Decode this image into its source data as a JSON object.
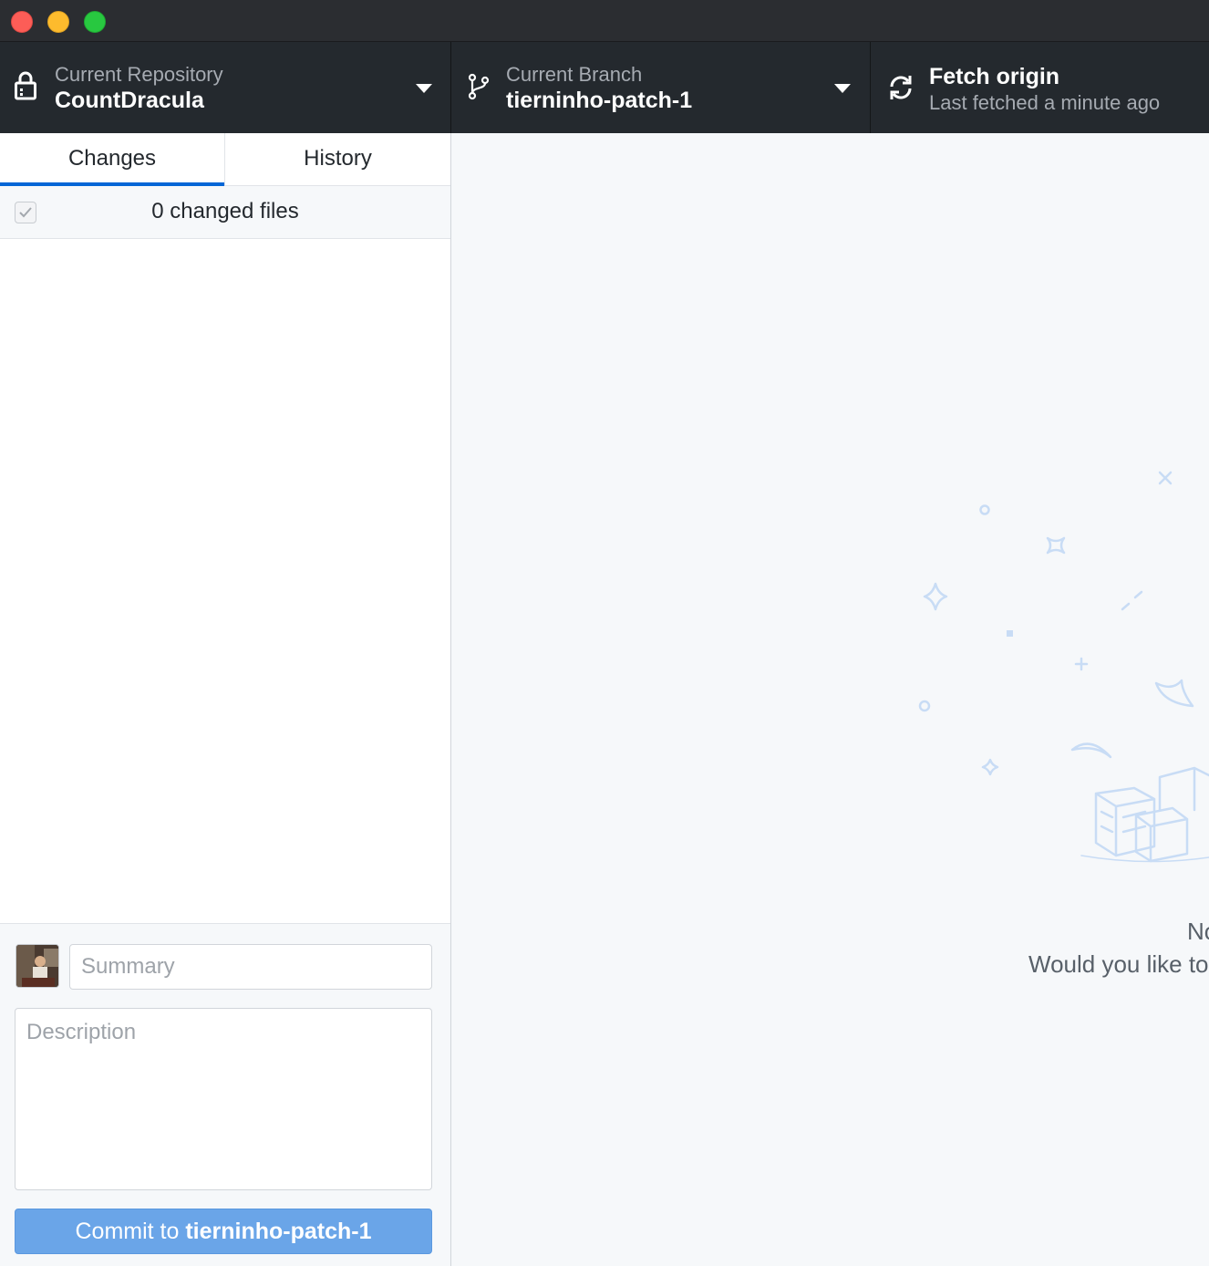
{
  "window": {
    "controls": [
      "close",
      "minimize",
      "maximize"
    ]
  },
  "toolbar": {
    "repository": {
      "label": "Current Repository",
      "value": "CountDracula",
      "icon": "lock-icon"
    },
    "branch": {
      "label": "Current Branch",
      "value": "tierninho-patch-1",
      "icon": "git-branch-icon"
    },
    "fetch": {
      "label": "Fetch origin",
      "status": "Last fetched a minute ago",
      "icon": "sync-icon"
    }
  },
  "sidebar": {
    "tabs": [
      {
        "label": "Changes",
        "selected": true
      },
      {
        "label": "History",
        "selected": false
      }
    ],
    "changed_files": "0 changed files",
    "commit": {
      "summary_placeholder": "Summary",
      "description_placeholder": "Description",
      "button_prefix": "Commit to",
      "button_branch": "tierninho-patch-1"
    }
  },
  "main": {
    "blank_title": "No",
    "blank_subtitle": "Would you like to"
  },
  "colors": {
    "toolbar_bg": "#24292e",
    "accent": "#0366d6",
    "commit_button": "#6aa5e8",
    "illustration": "#c8dcf5"
  }
}
